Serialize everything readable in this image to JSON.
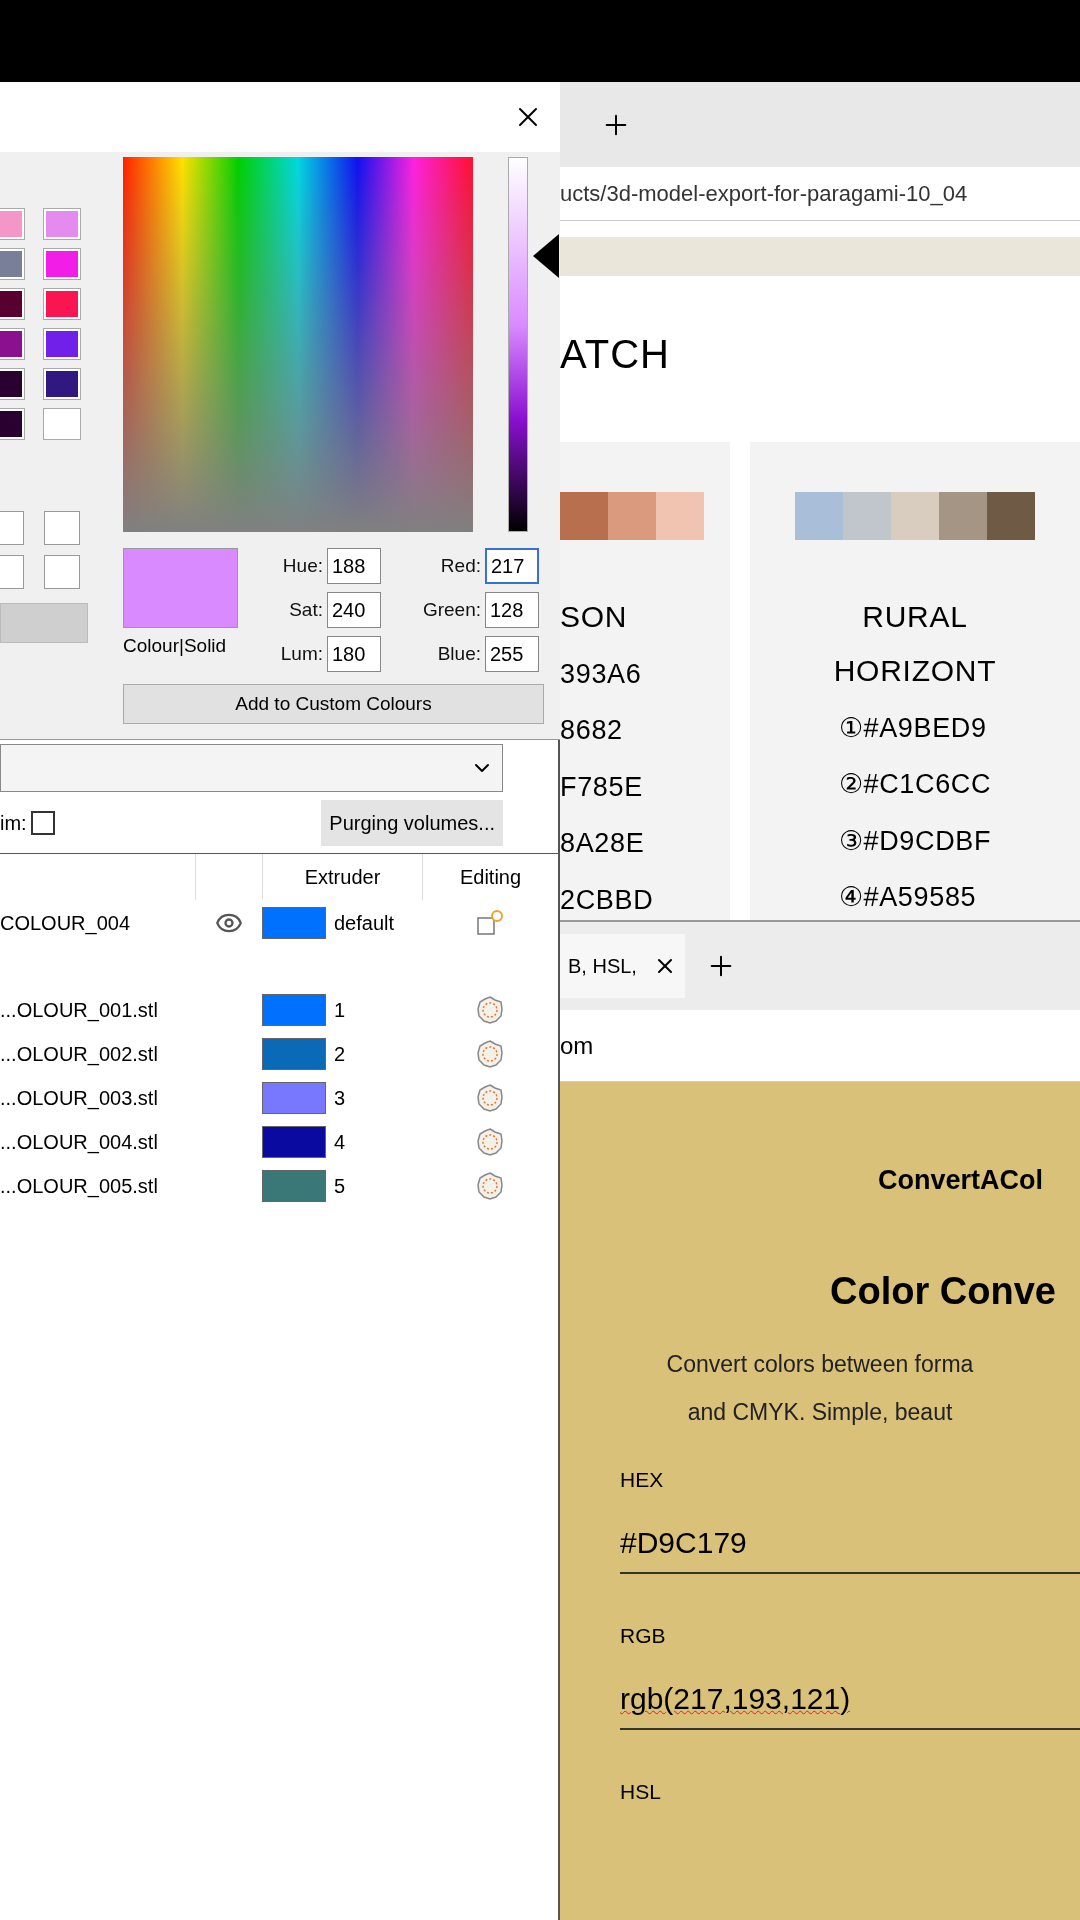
{
  "colour_dialog": {
    "basic_colours": [
      {
        "color": "#f497c8"
      },
      {
        "color": "#e58bf0"
      },
      {
        "color": "#7a7f99"
      },
      {
        "color": "#f21ee8"
      },
      {
        "color": "#5a0030"
      },
      {
        "color": "#fa1450"
      },
      {
        "color": "#8a1090"
      },
      {
        "color": "#7020e8"
      },
      {
        "color": "#2a0030"
      },
      {
        "color": "#301880"
      },
      {
        "color": "#2a0030"
      },
      {
        "color": "#ffffff"
      }
    ],
    "custom_colours": [
      {
        "color": "#ffffff"
      },
      {
        "color": "#ffffff"
      },
      {
        "color": "#ffffff"
      },
      {
        "color": "#ffffff"
      }
    ],
    "lum_slider": {
      "level": 0.74
    },
    "preview": {
      "color": "#d98aff",
      "label": "Colour|Solid"
    },
    "hsl_fields": [
      {
        "label": "Hue:",
        "value": "188",
        "focused": false
      },
      {
        "label": "Sat:",
        "value": "240",
        "focused": false
      },
      {
        "label": "Lum:",
        "value": "180",
        "focused": false
      }
    ],
    "rgb_fields": [
      {
        "label": "Red:",
        "value": "217",
        "focused": true
      },
      {
        "label": "Green:",
        "value": "128",
        "focused": false
      },
      {
        "label": "Blue:",
        "value": "255",
        "focused": false
      }
    ],
    "add_button": "Add to Custom Colours"
  },
  "slicer": {
    "wipe_label": "im:",
    "wipe_checked": false,
    "purge_button": "Purging volumes...",
    "columns": [
      "Extruder",
      "Editing"
    ],
    "rows": [
      {
        "kind": "object",
        "name": "COLOUR_004",
        "color": "#0070ff",
        "extruder": "default"
      },
      {
        "kind": "part",
        "name": "...OLOUR_001.stl",
        "color": "#0070ff",
        "extruder": "1"
      },
      {
        "kind": "part",
        "name": "...OLOUR_002.stl",
        "color": "#0a6ab8",
        "extruder": "2"
      },
      {
        "kind": "part",
        "name": "...OLOUR_003.stl",
        "color": "#7878ff",
        "extruder": "3"
      },
      {
        "kind": "part",
        "name": "...OLOUR_004.stl",
        "color": "#0a0aa0",
        "extruder": "4"
      },
      {
        "kind": "part",
        "name": "...OLOUR_005.stl",
        "color": "#3a7878",
        "extruder": "5"
      }
    ]
  },
  "browser_top": {
    "url": "ucts/3d-model-export-for-paragami-10_04",
    "heading": "ATCH",
    "cards": [
      {
        "title": "SON",
        "swatches": [
          {
            "color": "#b86f4e"
          },
          {
            "color": "#d99a7d"
          },
          {
            "color": "#f0c4b0"
          }
        ],
        "codes": [
          "393A6",
          "8682",
          "F785E",
          "8A28E",
          "2CBBD"
        ]
      },
      {
        "title": "RURAL HORIZONT",
        "swatches": [
          {
            "color": "#a9bed9"
          },
          {
            "color": "#c1c6cc"
          },
          {
            "color": "#d9cdbf"
          },
          {
            "color": "#a59585"
          },
          {
            "color": "#6e5a45"
          }
        ],
        "codes": [
          "①#A9BED9",
          "②#C1C6CC",
          "③#D9CDBF",
          "④#A59585"
        ]
      }
    ]
  },
  "browser_bottom": {
    "tab": {
      "label": "B, HSL,"
    },
    "url": "om",
    "logo": "ConvertACol",
    "title": "Color Conve",
    "description": [
      "Convert colors between forma",
      "and CMYK. Simple, beaut"
    ],
    "fields": [
      {
        "label": "HEX",
        "value": "#D9C179",
        "misspelt": false
      },
      {
        "label": "RGB",
        "value": "rgb(217,193,121)",
        "misspelt": true
      },
      {
        "label": "HSL"
      }
    ]
  }
}
